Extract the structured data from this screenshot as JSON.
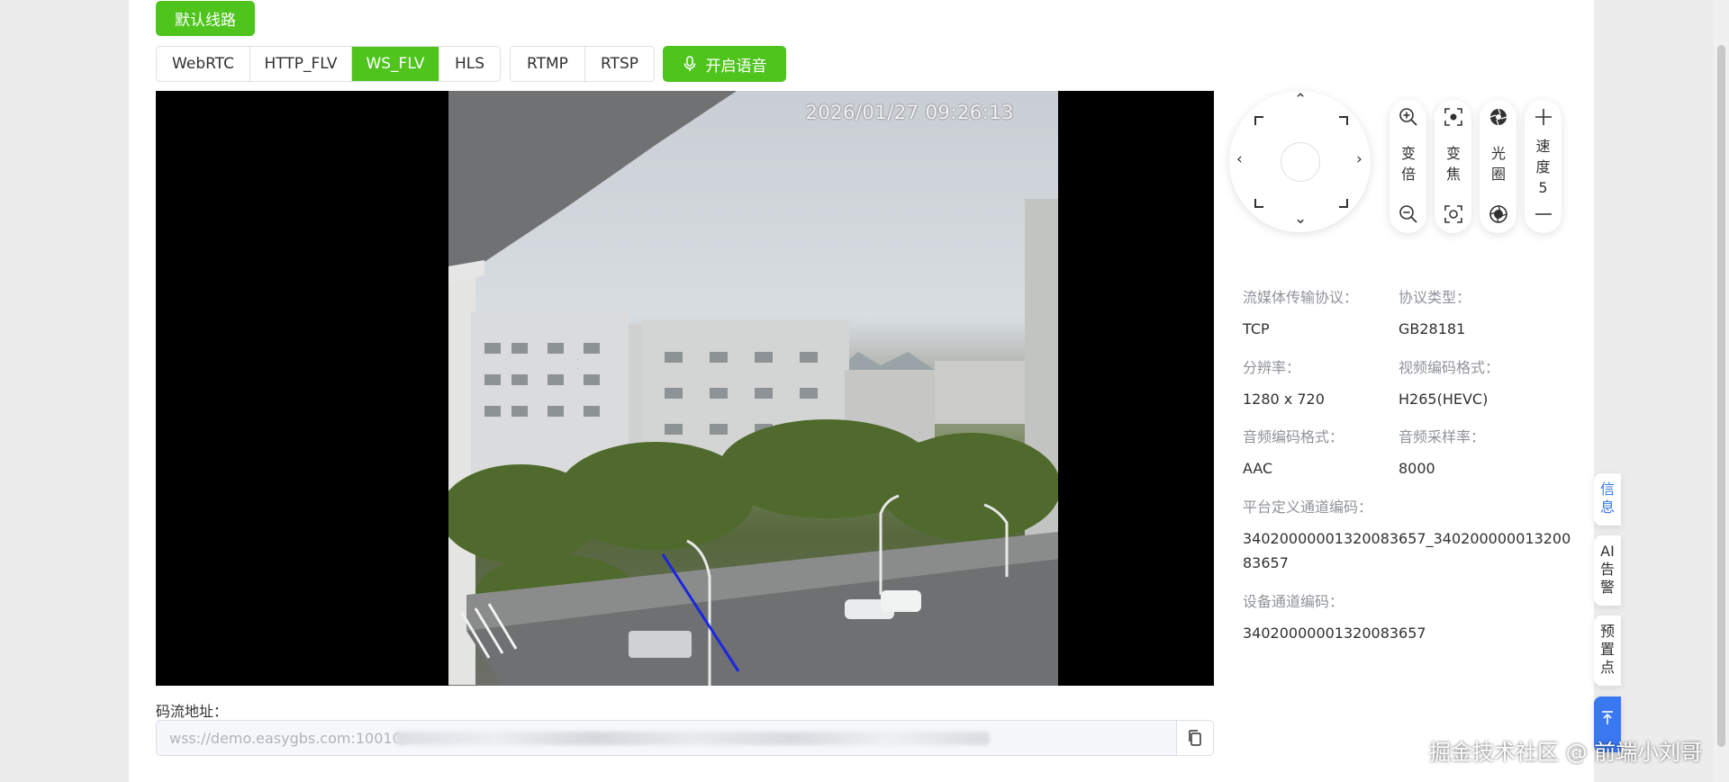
{
  "toolbar": {
    "default_route_label": "默认线路",
    "protocols_a": [
      "WebRTC",
      "HTTP_FLV",
      "WS_FLV",
      "HLS"
    ],
    "protocols_b": [
      "RTMP",
      "RTSP"
    ],
    "active_protocol": "WS_FLV",
    "voice_button_label": "开启语音"
  },
  "video": {
    "timestamp": "2026/01/27 09:26:13"
  },
  "ptz": {
    "zoom_label": "变倍",
    "focus_label": "变焦",
    "iris_label": "光圈",
    "speed_label": "速度",
    "speed_value": "5"
  },
  "info": {
    "protocol_key": "流媒体传输协议：",
    "protocol_value": "TCP",
    "protocol_type_key": "协议类型：",
    "protocol_type_value": "GB28181",
    "resolution_key": "分辨率：",
    "resolution_value": "1280 x 720",
    "video_codec_key": "视频编码格式：",
    "video_codec_value": "H265(HEVC)",
    "audio_codec_key": "音频编码格式：",
    "audio_codec_value": "AAC",
    "audio_rate_key": "音频采样率：",
    "audio_rate_value": "8000",
    "platform_channel_key": "平台定义通道编码：",
    "platform_channel_value_line1": "34020000001320083657_340200000013200",
    "platform_channel_value_line2": "83657",
    "device_channel_key": "设备通道编码：",
    "device_channel_value": "34020000001320083657"
  },
  "side_tabs": {
    "info": "信息",
    "ai_alarm": "AI告警",
    "preset": "预置点"
  },
  "stream": {
    "label": "码流地址：",
    "url_prefix": "wss://demo.easygbs.com:10010/"
  },
  "watermark": "掘金技术社区 @ 前端小刘哥",
  "colors": {
    "accent": "#4fc41d",
    "side_tab_active": "#3a78f2",
    "muted_text": "#909399"
  }
}
